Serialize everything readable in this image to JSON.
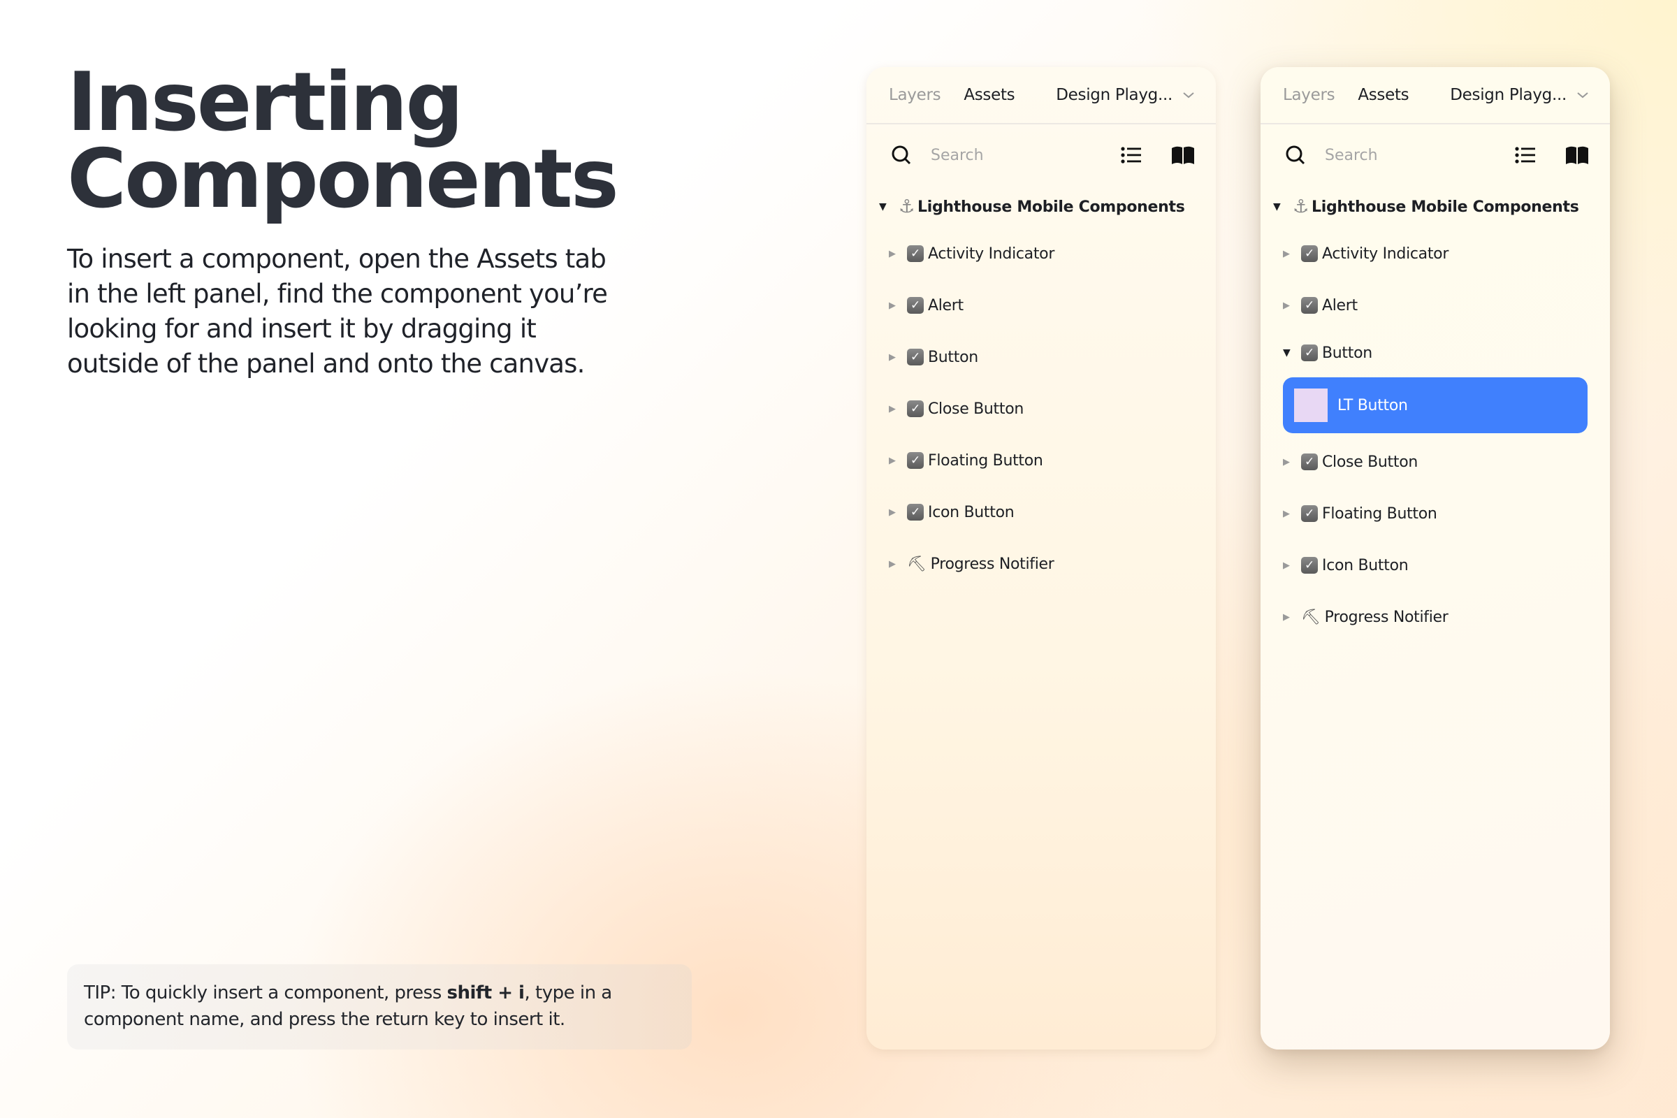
{
  "intro": {
    "title_line1": "Inserting",
    "title_line2": "Components",
    "description": "To insert a component, open the Assets tab in the left panel, find the component you’re looking for and insert it by dragging it outside of the panel and onto the canvas."
  },
  "tip": {
    "prefix": "TIP: To quickly insert a component, press ",
    "shortcut": "shift + i",
    "suffix": ", type in a component name, and press the return key to insert it."
  },
  "panels": [
    {
      "tabs": [
        {
          "label": "Layers",
          "active": false
        },
        {
          "label": "Assets",
          "active": true
        }
      ],
      "document": "Design Playg...",
      "search_placeholder": "Search",
      "library": "Lighthouse Mobile Components",
      "items": [
        {
          "label": "Activity Indicator",
          "icon": "checkbox-icon",
          "expanded": false
        },
        {
          "label": "Alert",
          "icon": "checkbox-icon",
          "expanded": false
        },
        {
          "label": "Button",
          "icon": "checkbox-icon",
          "expanded": false
        },
        {
          "label": "Close Button",
          "icon": "checkbox-icon",
          "expanded": false
        },
        {
          "label": "Floating Button",
          "icon": "checkbox-icon",
          "expanded": false
        },
        {
          "label": "Icon Button",
          "icon": "checkbox-icon",
          "expanded": false
        },
        {
          "label": "Progress Notifier",
          "icon": "hammer-icon",
          "expanded": false
        }
      ]
    },
    {
      "tabs": [
        {
          "label": "Layers",
          "active": false
        },
        {
          "label": "Assets",
          "active": true
        }
      ],
      "document": "Design Playg...",
      "search_placeholder": "Search",
      "library": "Lighthouse Mobile Components",
      "items": [
        {
          "label": "Activity Indicator",
          "icon": "checkbox-icon",
          "expanded": false
        },
        {
          "label": "Alert",
          "icon": "checkbox-icon",
          "expanded": false
        },
        {
          "label": "Button",
          "icon": "checkbox-icon",
          "expanded": true
        },
        {
          "label": "Close Button",
          "icon": "checkbox-icon",
          "expanded": false
        },
        {
          "label": "Floating Button",
          "icon": "checkbox-icon",
          "expanded": false
        },
        {
          "label": "Icon Button",
          "icon": "checkbox-icon",
          "expanded": false
        },
        {
          "label": "Progress Notifier",
          "icon": "hammer-icon",
          "expanded": false
        }
      ],
      "selected_child": {
        "label": "LT Button",
        "thumbnail_color": "#e8d8f4",
        "highlight_color": "#4080fd"
      }
    }
  ]
}
